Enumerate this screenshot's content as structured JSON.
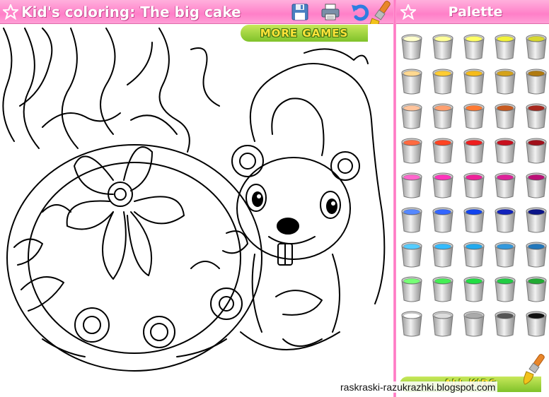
{
  "header": {
    "title": "Kid's coloring: The big cake",
    "more_games_label": "MORE GAMES"
  },
  "toolbar": {
    "save_icon": "floppy-disk-icon",
    "print_icon": "printer-icon",
    "undo_icon": "undo-arrow-icon",
    "brush_icon": "paint-brush-icon"
  },
  "palette": {
    "title": "Palette",
    "colors": [
      [
        "#ffffcc",
        "#ffff99",
        "#ffff66",
        "#f2f23a",
        "#d8d830"
      ],
      [
        "#ffd890",
        "#ffcc33",
        "#f5bb1a",
        "#d4a21a",
        "#b07a10"
      ],
      [
        "#ffc49c",
        "#ffa070",
        "#ff7a33",
        "#c85a20",
        "#a8281e"
      ],
      [
        "#ff6a40",
        "#ff4422",
        "#ee1e1e",
        "#c8101e",
        "#a0101a"
      ],
      [
        "#ff66cc",
        "#ff33bb",
        "#ee2299",
        "#dd2299",
        "#bb1177"
      ],
      [
        "#5588ff",
        "#3366ff",
        "#1144ee",
        "#1122bb",
        "#0a1488"
      ],
      [
        "#55ccff",
        "#33bbff",
        "#22aaee",
        "#3399dd",
        "#2277bb"
      ],
      [
        "#77ff77",
        "#44ee55",
        "#22dd44",
        "#22cc44",
        "#22aa33"
      ],
      [
        "#ffffff",
        "#dddddd",
        "#aaaaaa",
        "#555555",
        "#111111"
      ]
    ],
    "footer_label": "ALL KIDS"
  },
  "watermark": "raskraski-razukrazhki.blogspot.com"
}
